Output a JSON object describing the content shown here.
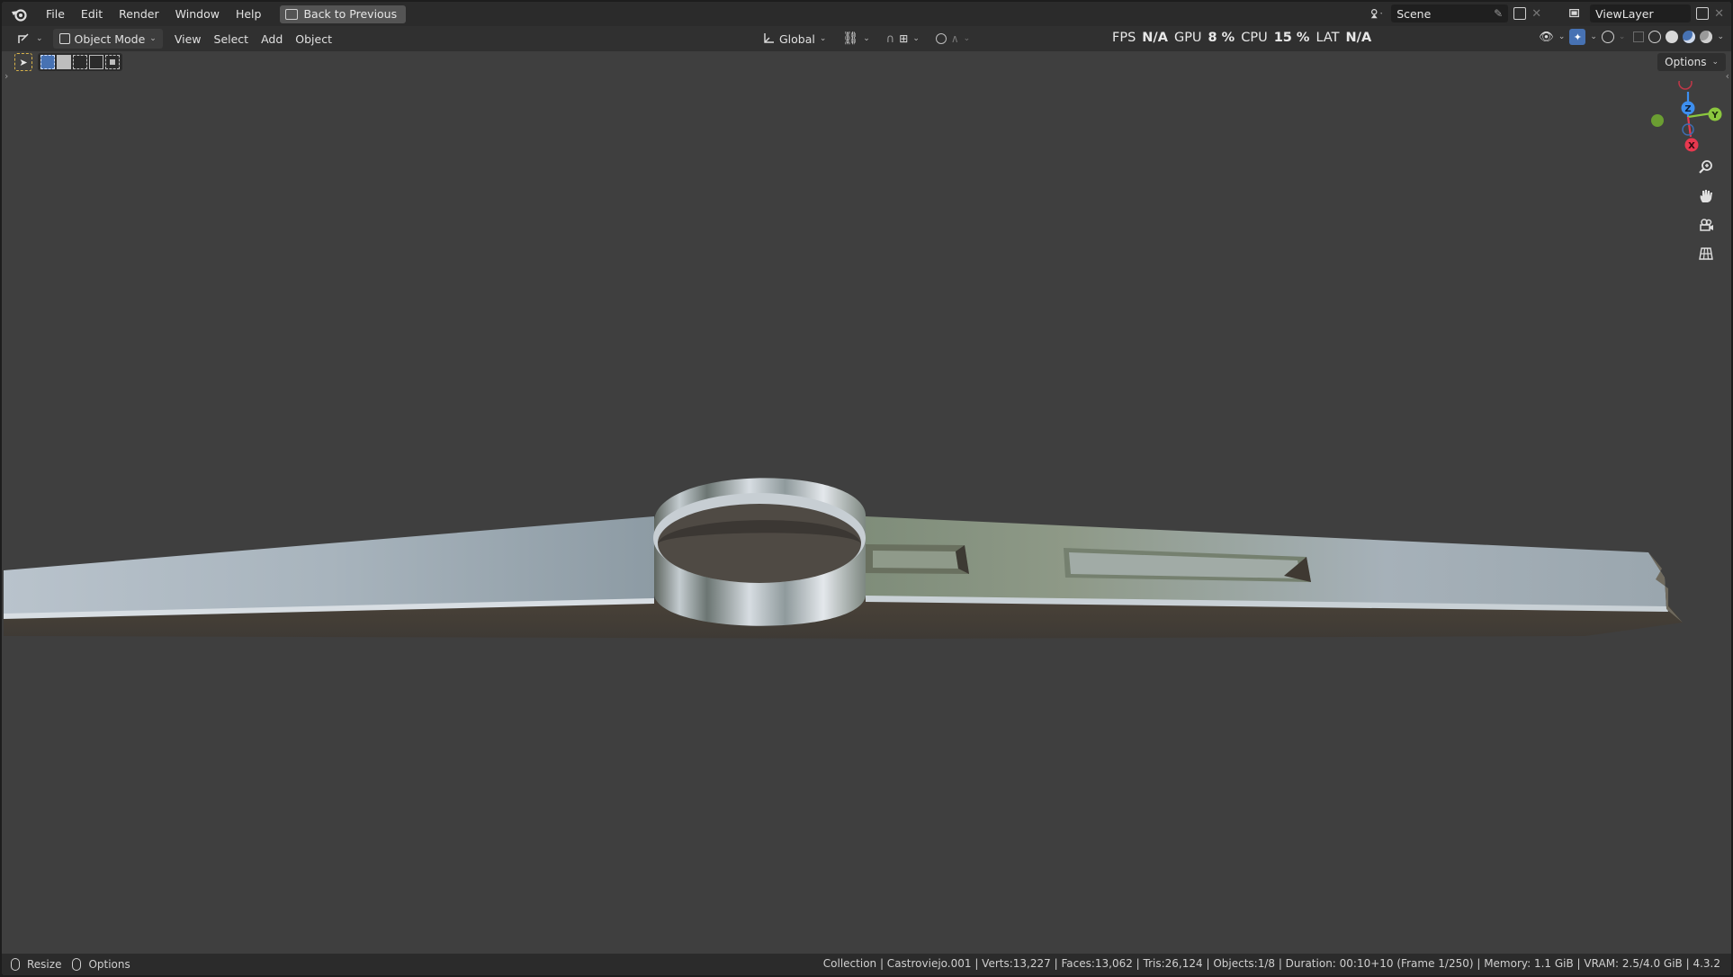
{
  "menu": {
    "items": [
      "File",
      "Edit",
      "Render",
      "Window",
      "Help"
    ],
    "back_button": "Back to Previous"
  },
  "top_right": {
    "scene_label": "Scene",
    "view_layer_label": "ViewLayer"
  },
  "header": {
    "mode": "Object Mode",
    "menus": [
      "View",
      "Select",
      "Add",
      "Object"
    ],
    "transform_orientation": "Global"
  },
  "stats": {
    "fps_label": "FPS",
    "fps_value": "N/A",
    "gpu_label": "GPU",
    "gpu_value": "8 %",
    "cpu_label": "CPU",
    "cpu_value": "15 %",
    "lat_label": "LAT",
    "lat_value": "N/A"
  },
  "viewport": {
    "options_label": "Options",
    "gizmo": {
      "x_label": "X",
      "y_label": "Y",
      "z_label": "Z"
    }
  },
  "status": {
    "left_action_1": "Resize",
    "left_action_2": "Options",
    "info": "Collection | Castroviejo.001 | Verts:13,227 | Faces:13,062 | Tris:26,124 | Objects:1/8 | Duration: 00:10+10 (Frame 1/250) | Memory: 1.1 GiB | VRAM: 2.5/4.0 GiB | 4.3.2"
  },
  "colors": {
    "accent": "#4772b3",
    "axis_x": "#e8384f",
    "axis_y": "#8bc73e",
    "axis_z": "#3d8ff0"
  }
}
